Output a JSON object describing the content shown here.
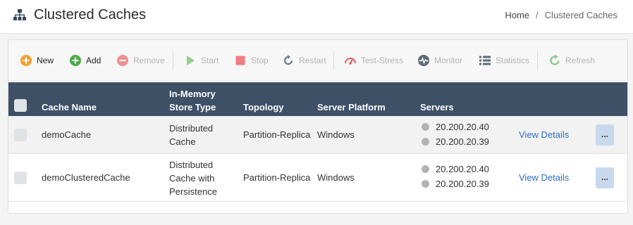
{
  "header": {
    "title": "Clustered Caches",
    "title_icon": "sitemap-icon",
    "breadcrumb": {
      "home": "Home",
      "separator": "/",
      "current": "Clustered Caches"
    }
  },
  "toolbar": {
    "buttons": [
      {
        "label": "New",
        "icon": "plus-circle-icon",
        "color": "#f0a030",
        "enabled": true
      },
      {
        "label": "Add",
        "icon": "plus-circle-icon",
        "color": "#4caa46",
        "enabled": true
      },
      {
        "label": "Remove",
        "icon": "minus-circle-icon",
        "color": "#ef9090",
        "enabled": false
      },
      {
        "label": "Start",
        "icon": "play-icon",
        "color": "#8fd08a",
        "enabled": false
      },
      {
        "label": "Stop",
        "icon": "stop-icon",
        "color": "#ef7b83",
        "enabled": false
      },
      {
        "label": "Restart",
        "icon": "refresh-icon",
        "color": "#6f7d8c",
        "enabled": false
      },
      {
        "label": "Test-Stress",
        "icon": "gauge-icon",
        "color": "#e35d5d",
        "enabled": false
      },
      {
        "label": "Monitor",
        "icon": "heartbeat-icon",
        "color": "#5c6a78",
        "enabled": false
      },
      {
        "label": "Statistics",
        "icon": "list-icon",
        "color": "#5c6a78",
        "enabled": false
      },
      {
        "label": "Refresh",
        "icon": "refresh-icon",
        "color": "#86c982",
        "enabled": false
      }
    ]
  },
  "table": {
    "columns": [
      "Cache Name",
      "In-Memory Store Type",
      "Topology",
      "Server Platform",
      "Servers"
    ],
    "column_lines": {
      "store_type_line1": "In-Memory",
      "store_type_line2": "Store Type"
    },
    "header_color": "#3d5066",
    "rows": [
      {
        "name": "demoCache",
        "store_type_lines": [
          "Distributed",
          "Cache"
        ],
        "topology": "Partition-Replica",
        "platform": "Windows",
        "servers": [
          "20.200.20.40",
          "20.200.20.39"
        ],
        "link": "View Details",
        "menu": "..."
      },
      {
        "name": "demoClusteredCache",
        "store_type_lines": [
          "Distributed",
          "Cache with",
          "Persistence"
        ],
        "topology": "Partition-Replica",
        "platform": "Windows",
        "servers": [
          "20.200.20.40",
          "20.200.20.39"
        ],
        "link": "View Details",
        "menu": "..."
      }
    ]
  }
}
